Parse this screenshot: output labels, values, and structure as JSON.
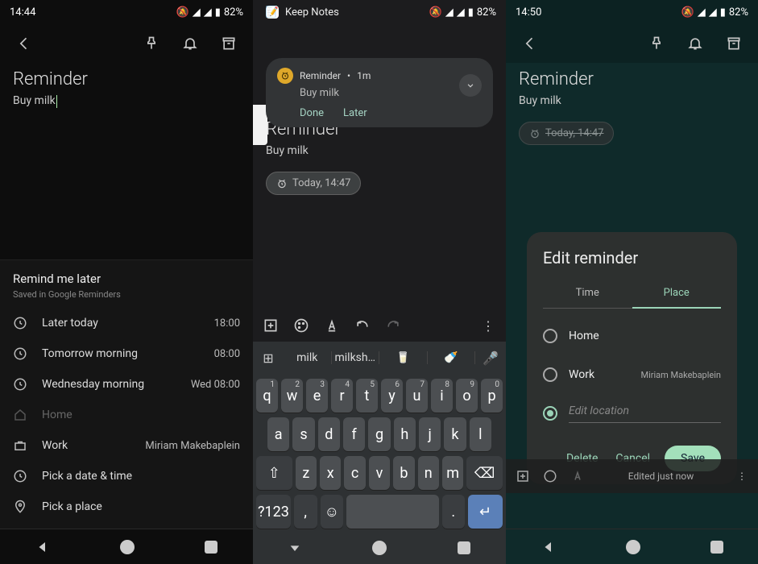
{
  "status": {
    "time1": "14:44",
    "time3": "14:50",
    "battery": "82%",
    "keepNotes": "Keep Notes"
  },
  "note": {
    "title": "Reminder",
    "body": "Buy milk"
  },
  "chip": {
    "today": "Today, 14:47"
  },
  "remindSheet": {
    "header": "Remind me later",
    "sub": "Saved in Google Reminders",
    "opts": {
      "laterToday": "Later today",
      "laterTodayVal": "18:00",
      "tomorrow": "Tomorrow morning",
      "tomorrowVal": "08:00",
      "wed": "Wednesday morning",
      "wedVal": "Wed 08:00",
      "home": "Home",
      "work": "Work",
      "workAddr": "Miriam Makebaplein",
      "pickDate": "Pick a date & time",
      "pickPlace": "Pick a place"
    }
  },
  "notif": {
    "title": "Reminder",
    "age": "1m",
    "body": "Buy milk",
    "done": "Done",
    "later": "Later"
  },
  "suggest": {
    "a": "milk",
    "b": "milkshake",
    "emoji1": "🥛",
    "emoji2": "🍼"
  },
  "keys": {
    "row1": [
      "q",
      "w",
      "e",
      "r",
      "t",
      "y",
      "u",
      "i",
      "o",
      "p"
    ],
    "nums": [
      "1",
      "2",
      "3",
      "4",
      "5",
      "6",
      "7",
      "8",
      "9",
      "0"
    ],
    "row2": [
      "a",
      "s",
      "d",
      "f",
      "g",
      "h",
      "j",
      "k",
      "l"
    ],
    "row3": [
      "z",
      "x",
      "c",
      "v",
      "b",
      "n",
      "m"
    ],
    "sym": "?123",
    "comma": ",",
    "period": "."
  },
  "edit": {
    "title": "Edit reminder",
    "tabTime": "Time",
    "tabPlace": "Place",
    "home": "Home",
    "work": "Work",
    "workAddr": "Miriam Makebaplein",
    "editLoc": "Edit location",
    "delete": "Delete",
    "cancel": "Cancel",
    "save": "Save"
  },
  "bottom": {
    "edited": "Edited just now"
  }
}
